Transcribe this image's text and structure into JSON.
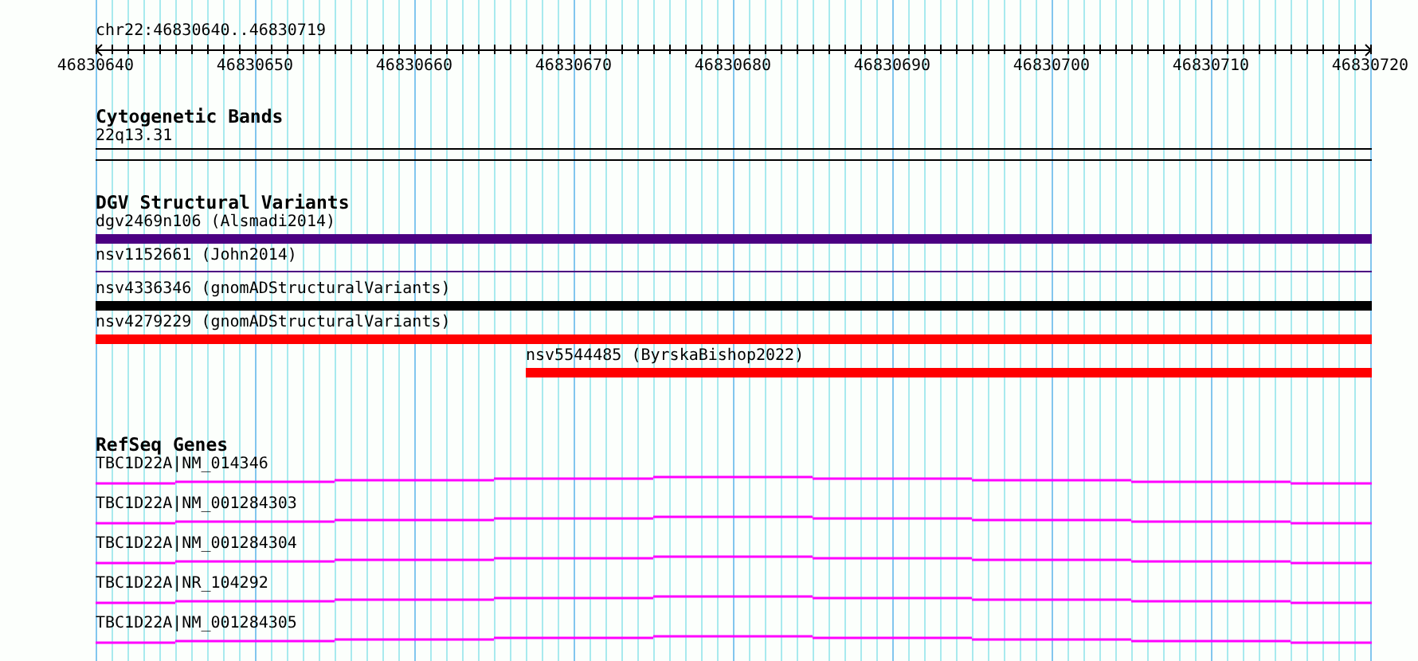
{
  "location": "chr22:46830640..46830719",
  "ruler": {
    "ticks": [
      "46830640",
      "46830650",
      "46830660",
      "46830670",
      "46830680",
      "46830690",
      "46830700",
      "46830710",
      "46830720"
    ]
  },
  "tracks": [
    {
      "kind": "band",
      "title": "Cytogenetic Bands",
      "items": [
        {
          "label": "22q13.31"
        }
      ]
    },
    {
      "kind": "variants",
      "title": "DGV Structural Variants",
      "items": [
        {
          "label": "dgv2469n106 (Alsmadi2014)",
          "kind": "bar",
          "color": "#4b0082",
          "level": 1
        },
        {
          "label": "nsv1152661 (John2014)",
          "kind": "line",
          "color": "#4b0082",
          "level": 1
        },
        {
          "label": "nsv4336346 (gnomADStructuralVariants)",
          "kind": "bar",
          "color": "#000000",
          "level": 1
        },
        {
          "label": "nsv4279229 (gnomADStructuralVariants)",
          "kind": "bar",
          "color": "#ff0000",
          "level": 1
        },
        {
          "label": "nsv5544485 (ByrskaBishop2022)",
          "kind": "bar",
          "color": "#ff0000",
          "level": 0.6625
        }
      ]
    },
    {
      "kind": "genes",
      "title": "RefSeq Genes",
      "items": [
        {
          "label": "TBC1D22A|NM_014346"
        },
        {
          "label": "TBC1D22A|NM_001284303"
        },
        {
          "label": "TBC1D22A|NM_001284304"
        },
        {
          "label": "TBC1D22A|NR_104292"
        },
        {
          "label": "TBC1D22A|NM_001284305"
        }
      ]
    }
  ]
}
